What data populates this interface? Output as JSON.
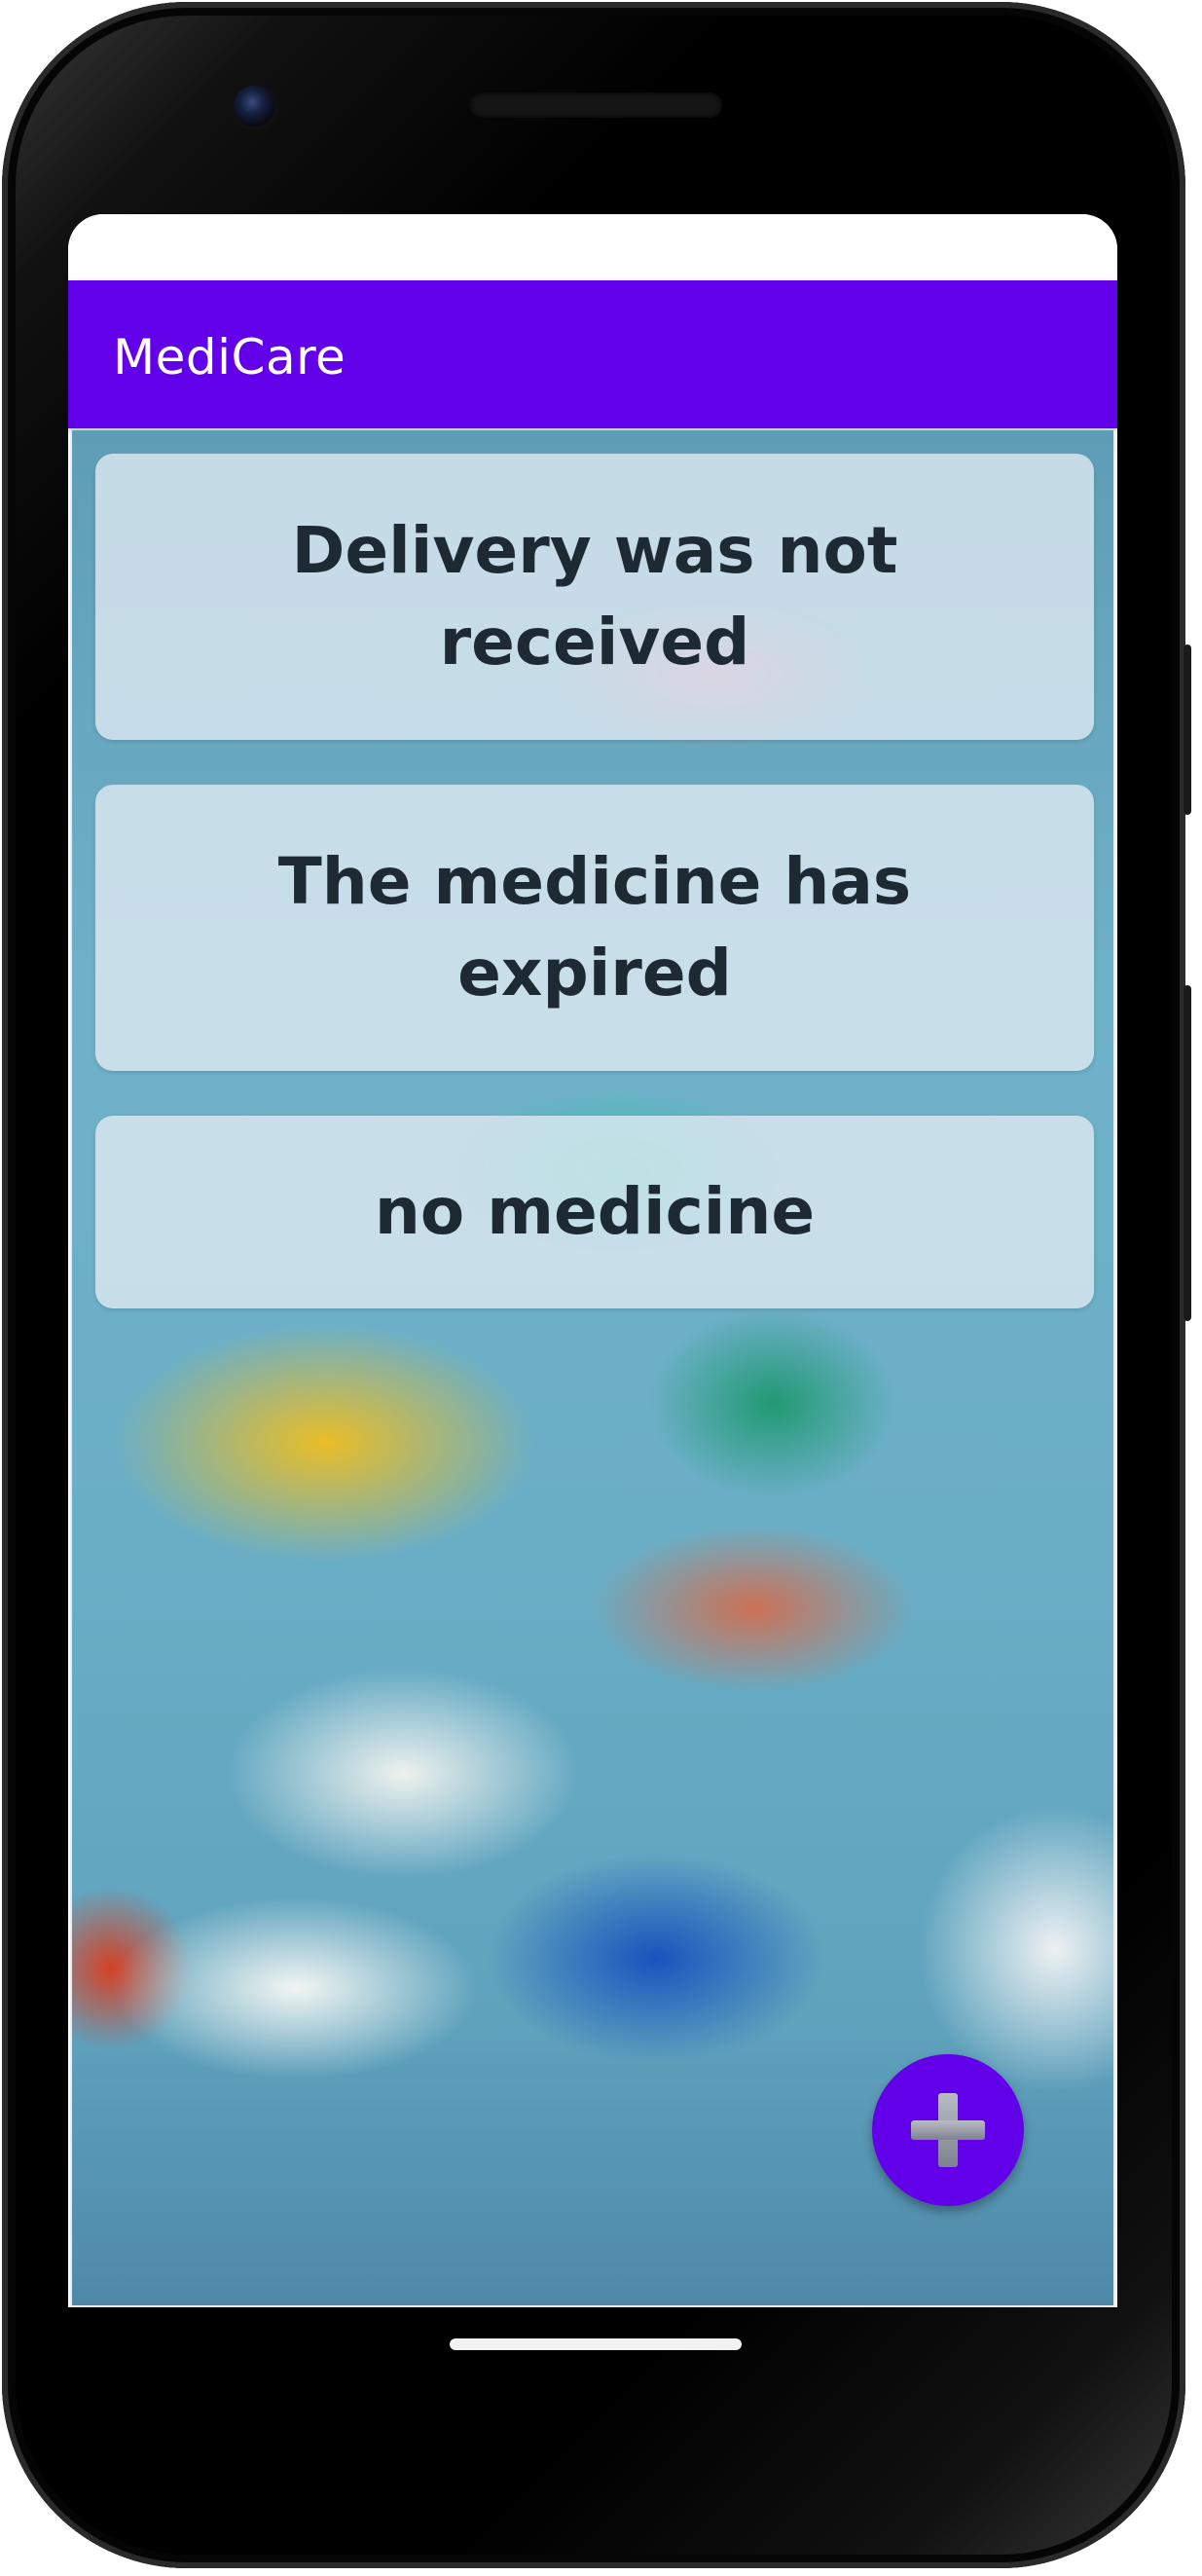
{
  "app_bar": {
    "title": "MediCare"
  },
  "complaints": [
    {
      "label": "Delivery was not received"
    },
    {
      "label": "The medicine has expired"
    },
    {
      "label": "no medicine"
    }
  ],
  "fab": {
    "icon": "plus-icon"
  },
  "colors": {
    "primary": "#6200ea",
    "card_background": "#dce8f0",
    "card_text": "#1e2a33",
    "app_bar_text": "#ffffff"
  }
}
